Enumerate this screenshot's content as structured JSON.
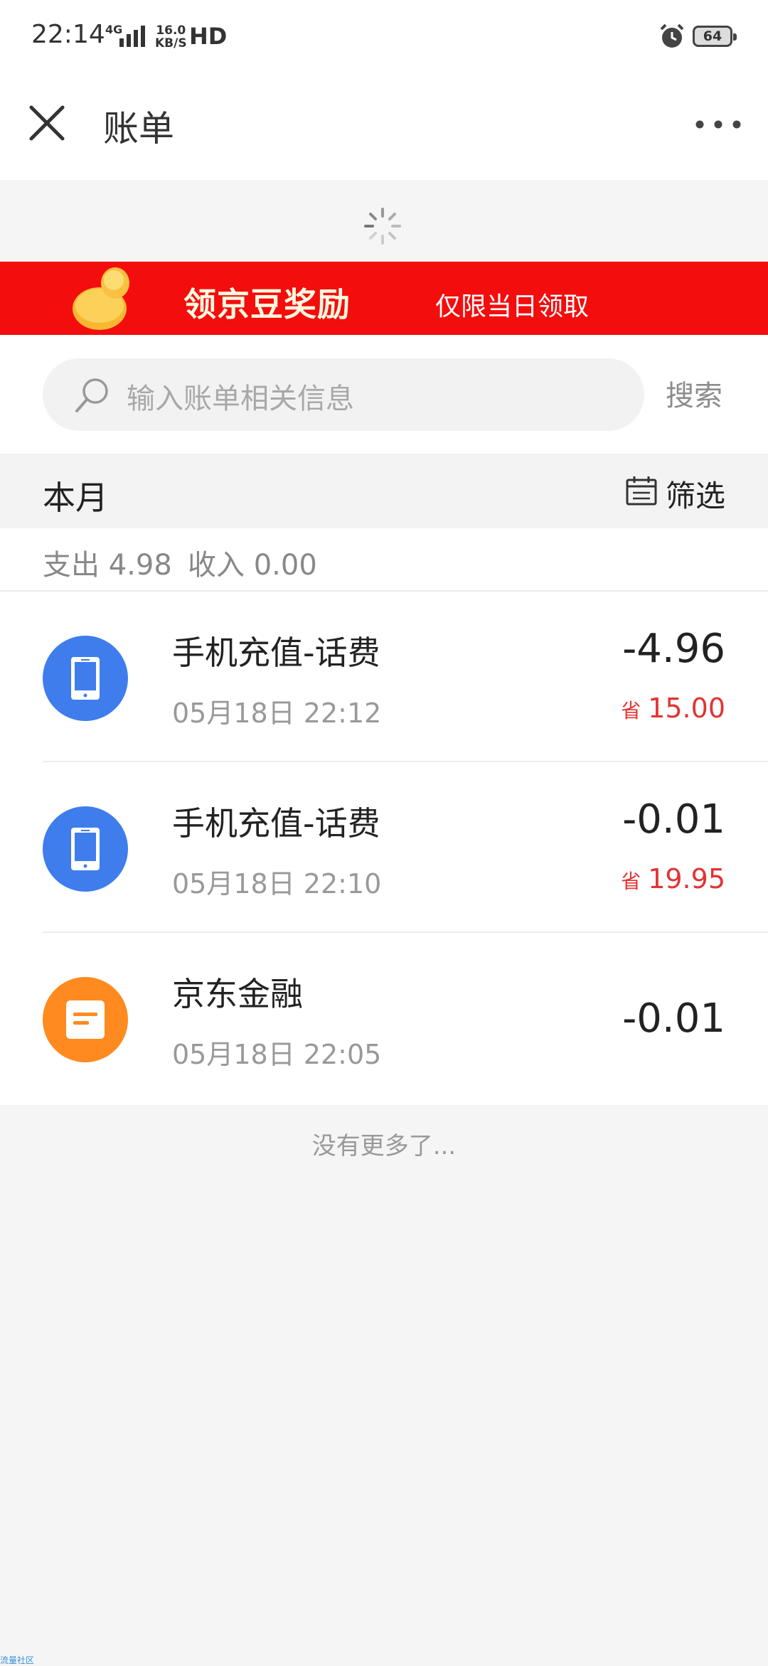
{
  "status_bar": {
    "time": "22:14",
    "network": "4G",
    "speed_value": "16.0",
    "speed_unit": "KB/S",
    "hd": "HD",
    "battery": "64"
  },
  "header": {
    "title": "账单",
    "close_icon": "close-icon",
    "more_icon": "more-dots-icon"
  },
  "banner": {
    "title": "领京豆奖励",
    "subtitle": "仅限当日领取",
    "background": "#f40d0d"
  },
  "search": {
    "placeholder": "输入账单相关信息",
    "button": "搜索"
  },
  "month_bar": {
    "label": "本月",
    "filter": "筛选"
  },
  "summary": {
    "expense": "支出 4.98",
    "income": "收入 0.00"
  },
  "transactions": [
    {
      "title": "手机充值-话费",
      "date": "05月18日 22:12",
      "amount": "-4.96",
      "save_label": "省",
      "save_value": "15.00",
      "icon": "phone-icon",
      "icon_color": "#3f7ded"
    },
    {
      "title": "手机充值-话费",
      "date": "05月18日 22:10",
      "amount": "-0.01",
      "save_label": "省",
      "save_value": "19.95",
      "icon": "phone-icon",
      "icon_color": "#3f7ded"
    },
    {
      "title": "京东金融",
      "date": "05月18日 22:05",
      "amount": "-0.01",
      "icon": "document-icon",
      "icon_color": "#ff8a1f"
    }
  ],
  "footer": {
    "no_more": "没有更多了...",
    "watermark": "流量社区"
  },
  "colors": {
    "accent_red": "#e33333",
    "page_bg": "#f5f5f5"
  }
}
